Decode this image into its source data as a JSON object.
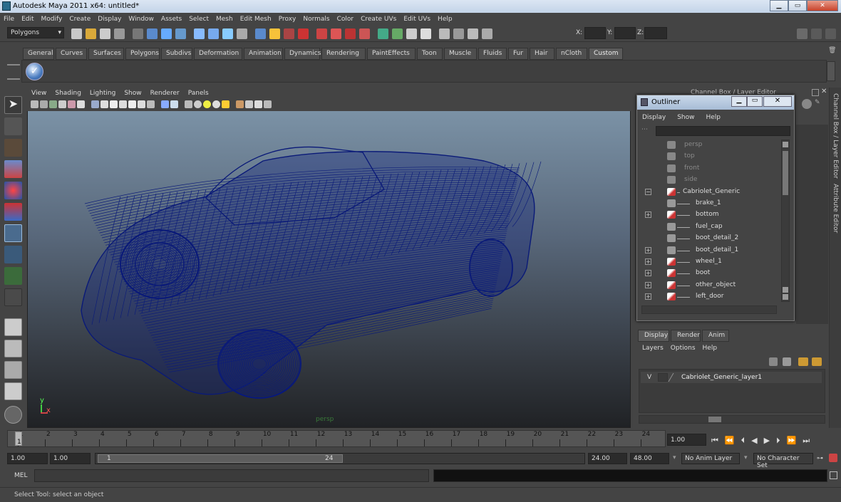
{
  "window": {
    "title": "Autodesk Maya 2011 x64: untitled*"
  },
  "menubar": [
    "File",
    "Edit",
    "Modify",
    "Create",
    "Display",
    "Window",
    "Assets",
    "Select",
    "Mesh",
    "Edit Mesh",
    "Proxy",
    "Normals",
    "Color",
    "Create UVs",
    "Edit UVs",
    "Help"
  ],
  "status": {
    "menuset": "Polygons",
    "x_label": "X:",
    "y_label": "Y:",
    "z_label": "Z:"
  },
  "shelf_tabs": [
    "General",
    "Curves",
    "Surfaces",
    "Polygons",
    "Subdivs",
    "Deformation",
    "Animation",
    "Dynamics",
    "Rendering",
    "PaintEffects",
    "Toon",
    "Muscle",
    "Fluids",
    "Fur",
    "Hair",
    "nCloth",
    "Custom"
  ],
  "shelf_active": "Custom",
  "viewport": {
    "menu": [
      "View",
      "Shading",
      "Lighting",
      "Show",
      "Renderer",
      "Panels"
    ],
    "camera_label": "persp",
    "axis_y": "y",
    "axis_x": "x"
  },
  "right_panel": {
    "header": "Channel Box / Layer Editor",
    "side_tab_1": "Channel Box / Layer Editor",
    "side_tab_2": "Attribute Editor"
  },
  "outliner": {
    "title": "Outliner",
    "menu": [
      "Display",
      "Show",
      "Help"
    ],
    "items": [
      {
        "label": "persp",
        "type": "camera",
        "expand": "",
        "indent": 0,
        "dim": true
      },
      {
        "label": "top",
        "type": "camera",
        "expand": "",
        "indent": 0,
        "dim": true
      },
      {
        "label": "front",
        "type": "camera",
        "expand": "",
        "indent": 0,
        "dim": true
      },
      {
        "label": "side",
        "type": "camera",
        "expand": "",
        "indent": 0,
        "dim": true
      },
      {
        "label": "Cabriolet_Generic",
        "type": "mesh",
        "expand": "−",
        "indent": 0,
        "dim": false
      },
      {
        "label": "brake_1",
        "type": "group",
        "expand": "",
        "indent": 1,
        "dim": false
      },
      {
        "label": "bottom",
        "type": "mesh",
        "expand": "+",
        "indent": 1,
        "dim": false
      },
      {
        "label": "fuel_cap",
        "type": "group",
        "expand": "",
        "indent": 1,
        "dim": false
      },
      {
        "label": "boot_detail_2",
        "type": "group",
        "expand": "",
        "indent": 1,
        "dim": false
      },
      {
        "label": "boot_detail_1",
        "type": "group",
        "expand": "+",
        "indent": 1,
        "dim": false
      },
      {
        "label": "wheel_1",
        "type": "mesh",
        "expand": "+",
        "indent": 1,
        "dim": false
      },
      {
        "label": "boot",
        "type": "mesh",
        "expand": "+",
        "indent": 1,
        "dim": false
      },
      {
        "label": "other_object",
        "type": "mesh",
        "expand": "+",
        "indent": 1,
        "dim": false
      },
      {
        "label": "left_door",
        "type": "mesh",
        "expand": "+",
        "indent": 1,
        "dim": false
      }
    ]
  },
  "layer_editor": {
    "tabs": [
      "Display",
      "Render",
      "Anim"
    ],
    "active_tab": "Display",
    "menu": [
      "Layers",
      "Options",
      "Help"
    ],
    "layer": {
      "visibility": "V",
      "name": "Cabriolet_Generic_layer1"
    }
  },
  "timeline": {
    "frames": [
      "1",
      "2",
      "3",
      "4",
      "5",
      "6",
      "7",
      "8",
      "9",
      "10",
      "11",
      "12",
      "13",
      "14",
      "15",
      "16",
      "17",
      "18",
      "19",
      "20",
      "21",
      "22",
      "23",
      "24"
    ],
    "current_frame": "1",
    "current_time_field": "1.00"
  },
  "range": {
    "start": "1.00",
    "playback_start": "1.00",
    "slider_start": "1",
    "slider_end": "24",
    "playback_end": "24.00",
    "end": "48.00",
    "anim_layer": "No Anim Layer",
    "character_set": "No Character Set"
  },
  "command_line": {
    "label": "MEL"
  },
  "help_line": {
    "text": "Select Tool: select an object"
  },
  "colors": {
    "wireframe": "#0a1a78",
    "panel_bg": "#444444",
    "title_bar": "#c3d4e8"
  }
}
